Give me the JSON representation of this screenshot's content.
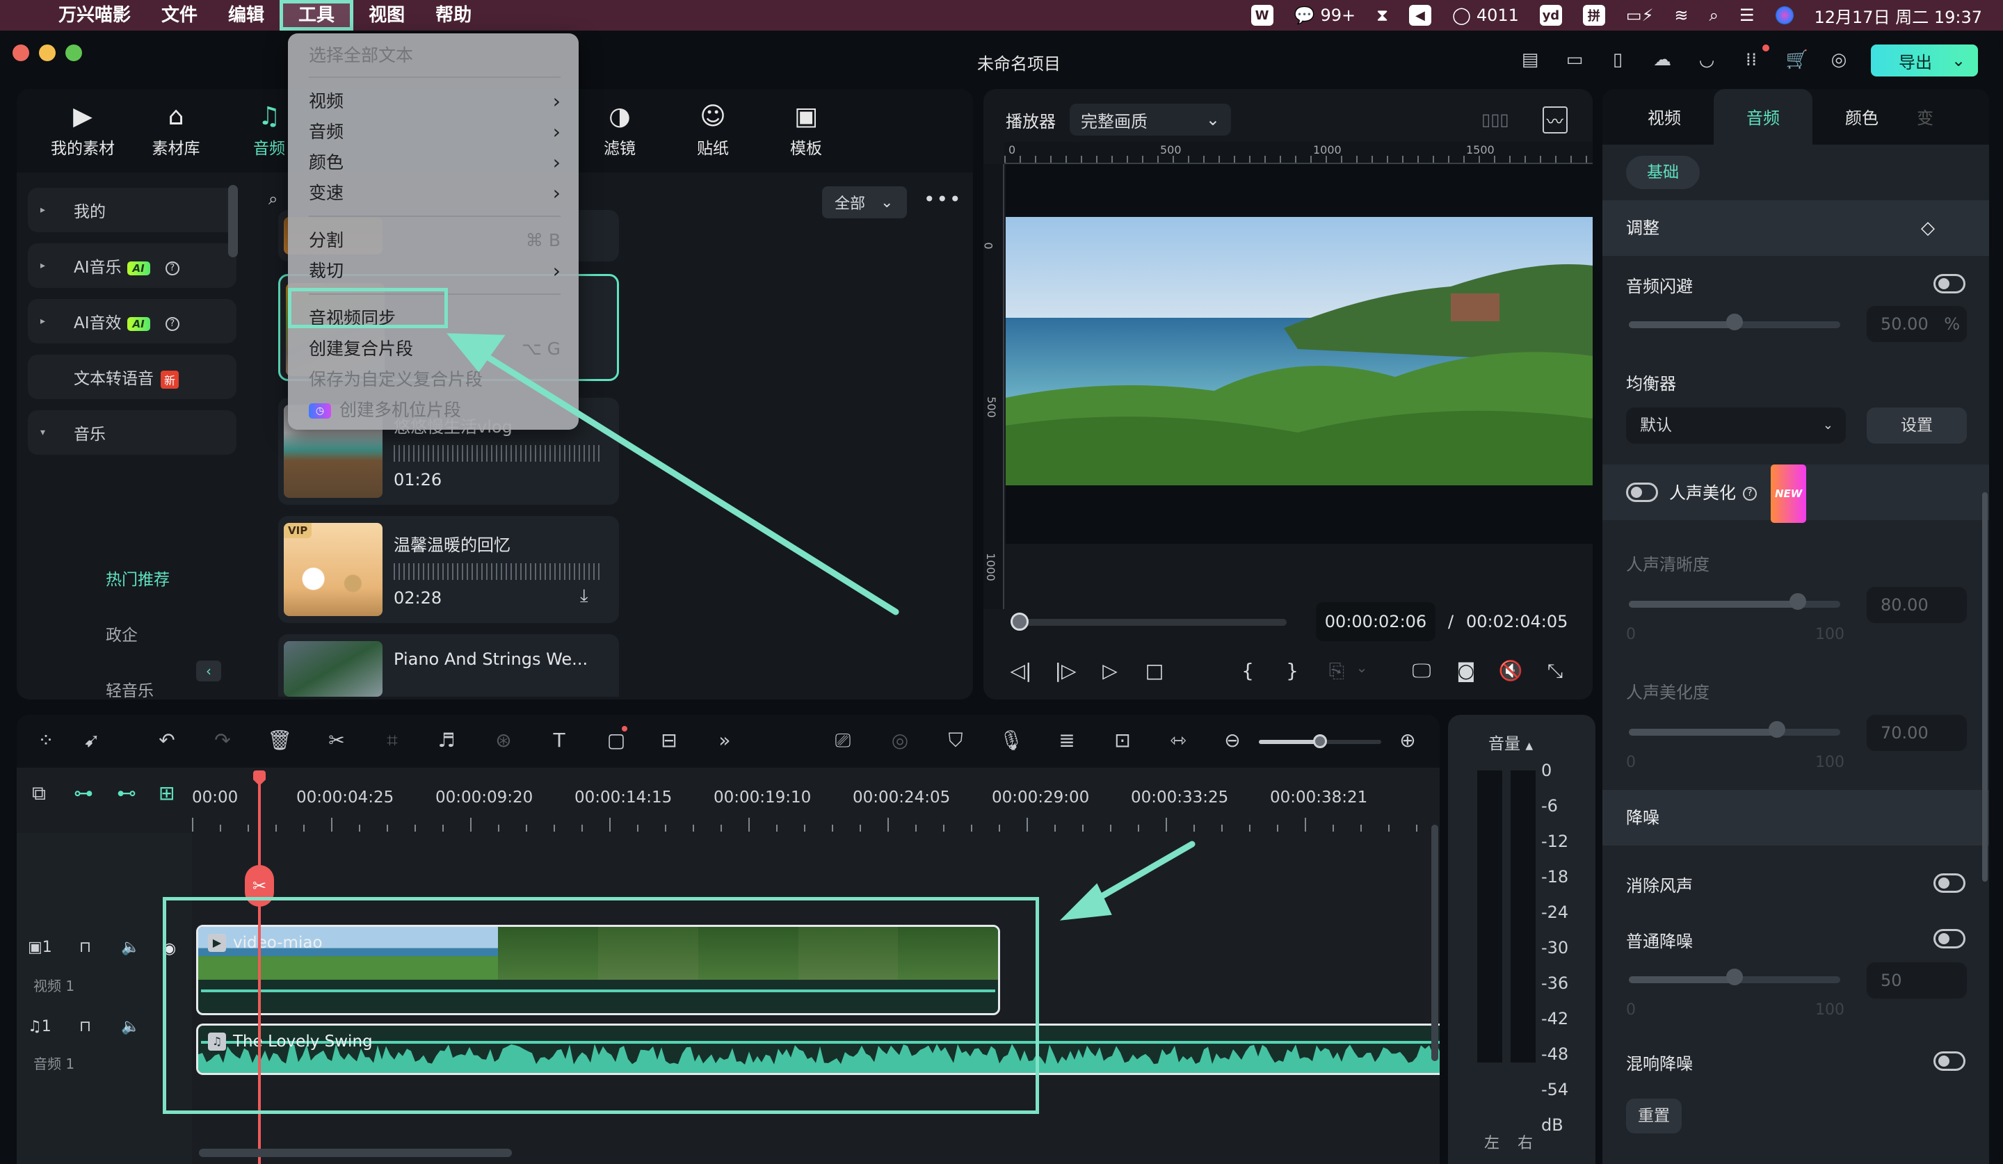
{
  "menubar": {
    "app_name": "万兴喵影",
    "items": [
      "文件",
      "编辑",
      "工具",
      "视图",
      "帮助"
    ],
    "active_item": "工具",
    "tray": {
      "wechat_count": "99+",
      "qq_count": "4011",
      "datetime": "12月17日 周二 19:37"
    }
  },
  "window": {
    "project_title": "未命名项目",
    "export_label": "导出",
    "top_icons": [
      "history-icon",
      "layout-icon",
      "save-icon",
      "cloud-icon",
      "headset-icon",
      "apps-icon",
      "cart-icon",
      "user-icon"
    ]
  },
  "tools_menu": {
    "items": [
      {
        "label": "选择全部文本",
        "disabled": true
      },
      {
        "label": "视频",
        "submenu": true
      },
      {
        "label": "音频",
        "submenu": true
      },
      {
        "label": "颜色",
        "submenu": true
      },
      {
        "label": "变速",
        "submenu": true
      },
      {
        "label": "分割",
        "shortcut": "⌘ B"
      },
      {
        "label": "裁切",
        "submenu": true
      },
      {
        "label": "音视频同步",
        "highlighted": true
      },
      {
        "label": "创建复合片段",
        "shortcut": "⌥ G"
      },
      {
        "label": "保存为自定义复合片段",
        "disabled": true
      },
      {
        "label": "创建多机位片段",
        "disabled": true
      }
    ]
  },
  "library": {
    "tabs": [
      {
        "label": "我的素材",
        "icon": "media-icon"
      },
      {
        "label": "素材库",
        "icon": "store-icon"
      },
      {
        "label": "音频",
        "icon": "music-note-icon",
        "active": true
      },
      {
        "label": "滤镜",
        "icon": "filter-icon"
      },
      {
        "label": "贴纸",
        "icon": "sticker-icon"
      },
      {
        "label": "模板",
        "icon": "template-icon"
      }
    ],
    "categories": [
      {
        "label": "我的",
        "expand": "▸"
      },
      {
        "label": "AI音乐",
        "expand": "▸",
        "badge": "AI"
      },
      {
        "label": "AI音效",
        "expand": "▸",
        "badge": "AI"
      },
      {
        "label": "文本转语音",
        "badge_new": "新"
      },
      {
        "label": "音乐",
        "expand": "▾"
      }
    ],
    "subcategories": [
      {
        "label": "热门推荐",
        "active": true
      },
      {
        "label": "政企"
      },
      {
        "label": "轻音乐"
      }
    ],
    "filter_label": "全部",
    "tracks": [
      {
        "name": "",
        "duration": ""
      },
      {
        "name": "",
        "duration": "",
        "selected": true
      },
      {
        "name": "悠悠慢生活vlog",
        "duration": "01:26"
      },
      {
        "name": "温馨温暖的回忆",
        "duration": "02:28",
        "vip": "VIP"
      },
      {
        "name": "Piano And Strings We...",
        "duration": ""
      }
    ]
  },
  "player": {
    "label": "播放器",
    "quality": "完整画质",
    "ruler_h": [
      "0",
      "500",
      "1000",
      "1500"
    ],
    "ruler_v": [
      "0",
      "500",
      "1000"
    ],
    "current_time": "00:00:02:06",
    "separator": "/",
    "total_time": "00:02:04:05",
    "progress_fraction": 0.017
  },
  "inspector": {
    "tabs": [
      "视频",
      "音频",
      "颜色",
      "变速"
    ],
    "active_tab": "音频",
    "subtab": "基础",
    "adjust_header": "调整",
    "ducking": {
      "label": "音频闪避",
      "on": false,
      "value": "50.00",
      "unit": "%",
      "fraction": 0.5
    },
    "equalizer": {
      "label": "均衡器",
      "preset": "默认",
      "settings_label": "设置"
    },
    "voice_enhance": {
      "label": "人声美化",
      "on": false,
      "badge": "NEW"
    },
    "clarity": {
      "label": "人声清晰度",
      "value": "80.00",
      "fraction": 0.8,
      "min": "0",
      "max": "100"
    },
    "beautify": {
      "label": "人声美化度",
      "value": "70.00",
      "fraction": 0.7,
      "min": "0",
      "max": "100"
    },
    "denoise_header": "降噪",
    "wind": {
      "label": "消除风声",
      "on": false
    },
    "normal_denoise": {
      "label": "普通降噪",
      "on": false,
      "value": "50",
      "fraction": 0.5,
      "min": "0",
      "max": "100"
    },
    "reverb": {
      "label": "混响降噪",
      "on": false
    },
    "reset_label": "重置"
  },
  "timeline": {
    "ruler": [
      "00:00",
      "00:00:04:25",
      "00:00:09:20",
      "00:00:14:15",
      "00:00:19:10",
      "00:00:24:05",
      "00:00:29:00",
      "00:00:33:25",
      "00:00:38:21"
    ],
    "tracks": [
      {
        "icon": "video-track-icon",
        "index": "1",
        "name": "视频 1"
      },
      {
        "icon": "audio-track-icon",
        "index": "1",
        "name": "音频 1"
      }
    ],
    "clips": {
      "video": "video-miao",
      "audio": "The Lovely Swing"
    },
    "zoom_fraction": 0.5
  },
  "meter": {
    "title": "音量",
    "scale": [
      "0",
      "-6",
      "-12",
      "-18",
      "-24",
      "-30",
      "-36",
      "-42",
      "-48",
      "-54",
      "dB"
    ],
    "left": "左",
    "right": "右"
  },
  "colors": {
    "accent": "#5fe3c1",
    "annotation": "#7ee2c6",
    "playhead": "#ef5a5a"
  }
}
